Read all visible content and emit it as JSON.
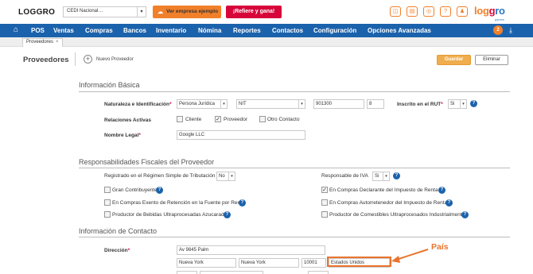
{
  "topbar": {
    "logo": "LOGGRO",
    "company": "CEDI Nacional…",
    "demo_button": "Ver empresa ejemplo",
    "refer_button": "¡Refiere y gana!",
    "icons": [
      "chat-icon",
      "news-icon",
      "support-icon",
      "question-icon",
      "user-icon"
    ],
    "icon_glyphs": [
      "◫",
      "▤",
      "◎",
      "?",
      "♟"
    ],
    "brand": {
      "part1": "log",
      "part2": "g",
      "part3": "ro"
    },
    "brand_sub": "pymes"
  },
  "nav": {
    "items": [
      "POS",
      "Ventas",
      "Compras",
      "Bancos",
      "Inventario",
      "Nómina",
      "Reportes",
      "Contactos",
      "Configuración",
      "Opciones Avanzadas"
    ],
    "badge": "2"
  },
  "tabs": [
    {
      "label": "Proveedores"
    }
  ],
  "header": {
    "title": "Proveedores",
    "new_label": "Nuevo Proveedor",
    "save": "Guardar",
    "delete": "Eliminar"
  },
  "basic": {
    "title": "Información Básica",
    "nature_label": "Naturaleza e Identificación",
    "nature_value": "Persona Jurídica",
    "doc_type": "NIT",
    "doc_number": "901300",
    "dv": "8",
    "rut_label": "Inscrito en el RUT",
    "rut_value": "Si",
    "relations_label": "Relaciones Activas",
    "relations": [
      {
        "label": "Cliente",
        "checked": false
      },
      {
        "label": "Proveedor",
        "checked": true
      },
      {
        "label": "Otro Contacto",
        "checked": false
      }
    ],
    "legal_name_label": "Nombre Legal",
    "legal_name_value": "Google LLC"
  },
  "fiscal": {
    "title": "Responsabilidades Fiscales del Proveedor",
    "simple_label": "Registrado en el Régimen Simple de Tributación",
    "simple_value": "No",
    "iva_label": "Responsable de IVA",
    "iva_value": "Si",
    "checks_left": [
      {
        "label": "Gran Contribuyente",
        "checked": false
      },
      {
        "label": "En Compras Exento de Retención en la Fuente por Renta",
        "checked": false
      },
      {
        "label": "Productor de Bebidas Ultraprocesadas Azucaradas",
        "checked": false
      }
    ],
    "checks_right": [
      {
        "label": "En Compras Declarante del Impuesto de Renta",
        "checked": true
      },
      {
        "label": "En Compras Autorretenedor del Impuesto de Renta",
        "checked": false
      },
      {
        "label": "Productor de Comestibles Ultraprocesados Industrialmente",
        "checked": false
      }
    ]
  },
  "contact": {
    "title": "Información de Contacto",
    "address_label": "Dirección",
    "address_value": "Av 9845 Palm",
    "city": "Nueva York",
    "state": "Nueva York",
    "zip": "10001",
    "country": "Estados Unidos"
  },
  "annotation": {
    "label": "País",
    "color": "#e8742e"
  }
}
